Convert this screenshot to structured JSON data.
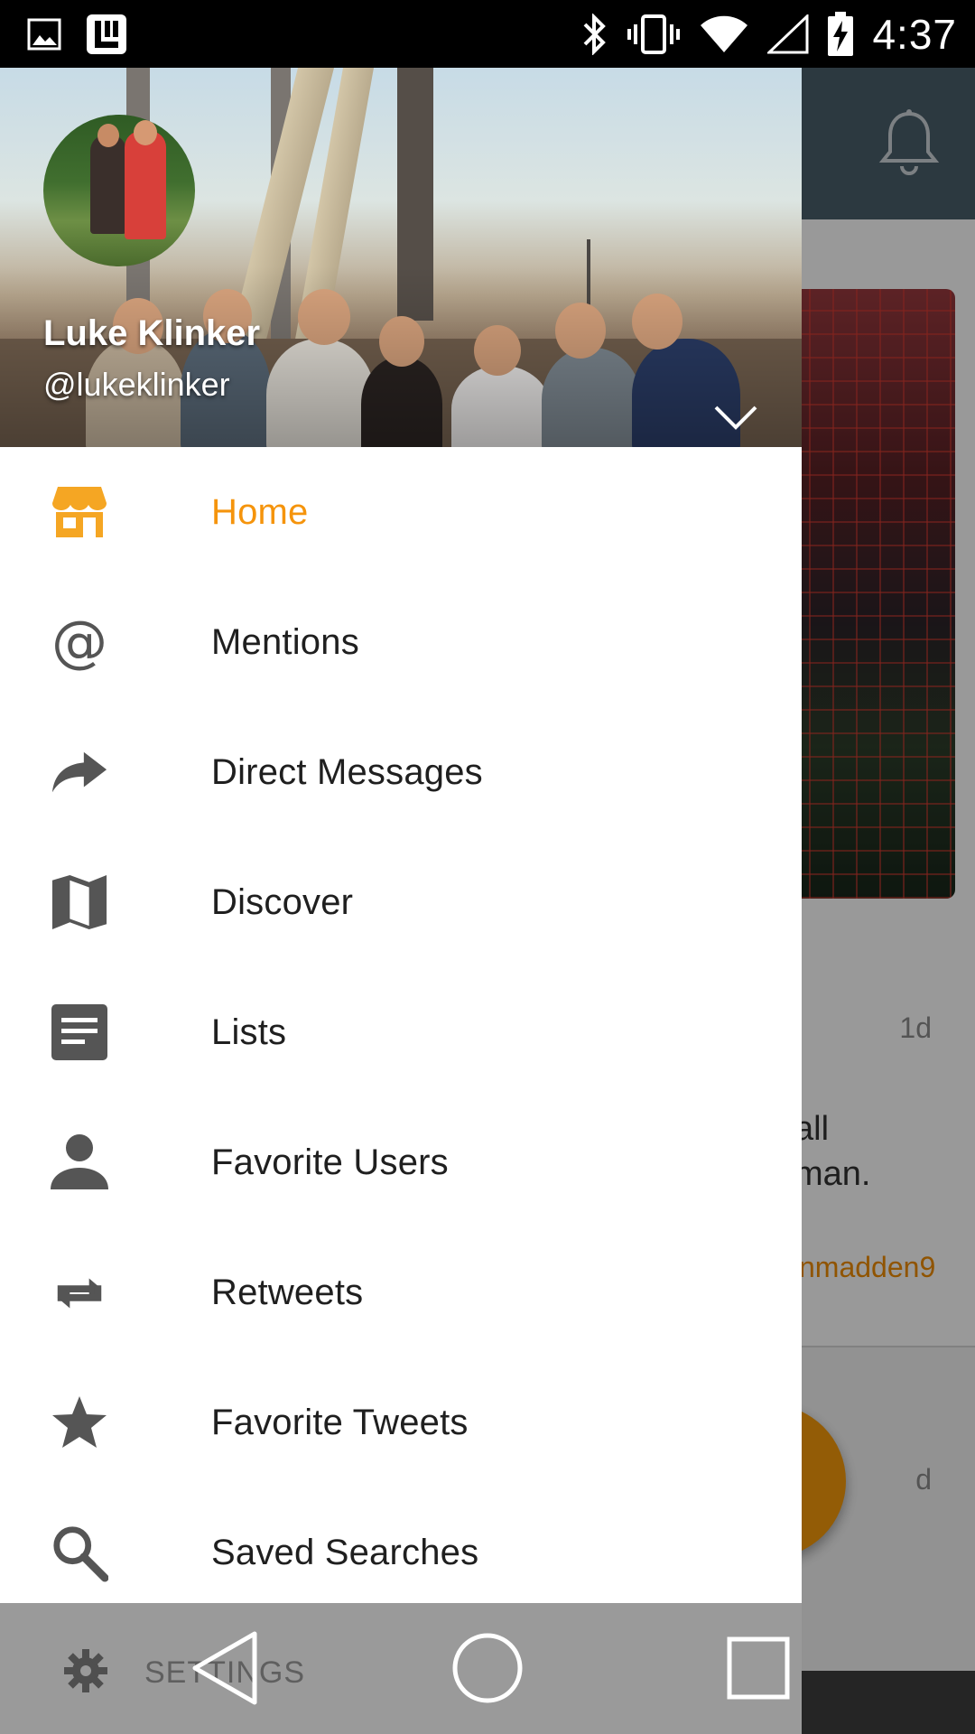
{
  "status_bar": {
    "time": "4:37",
    "left_icons": [
      "image-icon",
      "app-notification-icon"
    ],
    "right_icons": [
      "bluetooth-icon",
      "vibrate-icon",
      "wifi-icon",
      "cell-signal-icon",
      "battery-charging-icon"
    ]
  },
  "drawer": {
    "user": {
      "name": "Luke Klinker",
      "handle": "@lukeklinker"
    },
    "menu": [
      {
        "label": "Home",
        "icon": "home-store-icon",
        "active": true
      },
      {
        "label": "Mentions",
        "icon": "at-icon",
        "active": false
      },
      {
        "label": "Direct Messages",
        "icon": "share-arrow-icon",
        "active": false
      },
      {
        "label": "Discover",
        "icon": "map-icon",
        "active": false
      },
      {
        "label": "Lists",
        "icon": "document-icon",
        "active": false
      },
      {
        "label": "Favorite Users",
        "icon": "person-icon",
        "active": false
      },
      {
        "label": "Retweets",
        "icon": "retweet-icon",
        "active": false
      },
      {
        "label": "Favorite Tweets",
        "icon": "star-icon",
        "active": false
      },
      {
        "label": "Saved Searches",
        "icon": "search-icon",
        "active": false
      }
    ],
    "settings_label": "SETTINGS"
  },
  "background": {
    "tweet_time": "1d",
    "tweet_text": "all\nman.",
    "tweet_handle": "nmadden9",
    "tweet_time_2": "d"
  },
  "colors": {
    "accent": "#f5940c",
    "toolbar": "#4a5f6b",
    "fab": "#f59a0a"
  },
  "nav": [
    "back-icon",
    "home-icon",
    "recents-icon"
  ]
}
